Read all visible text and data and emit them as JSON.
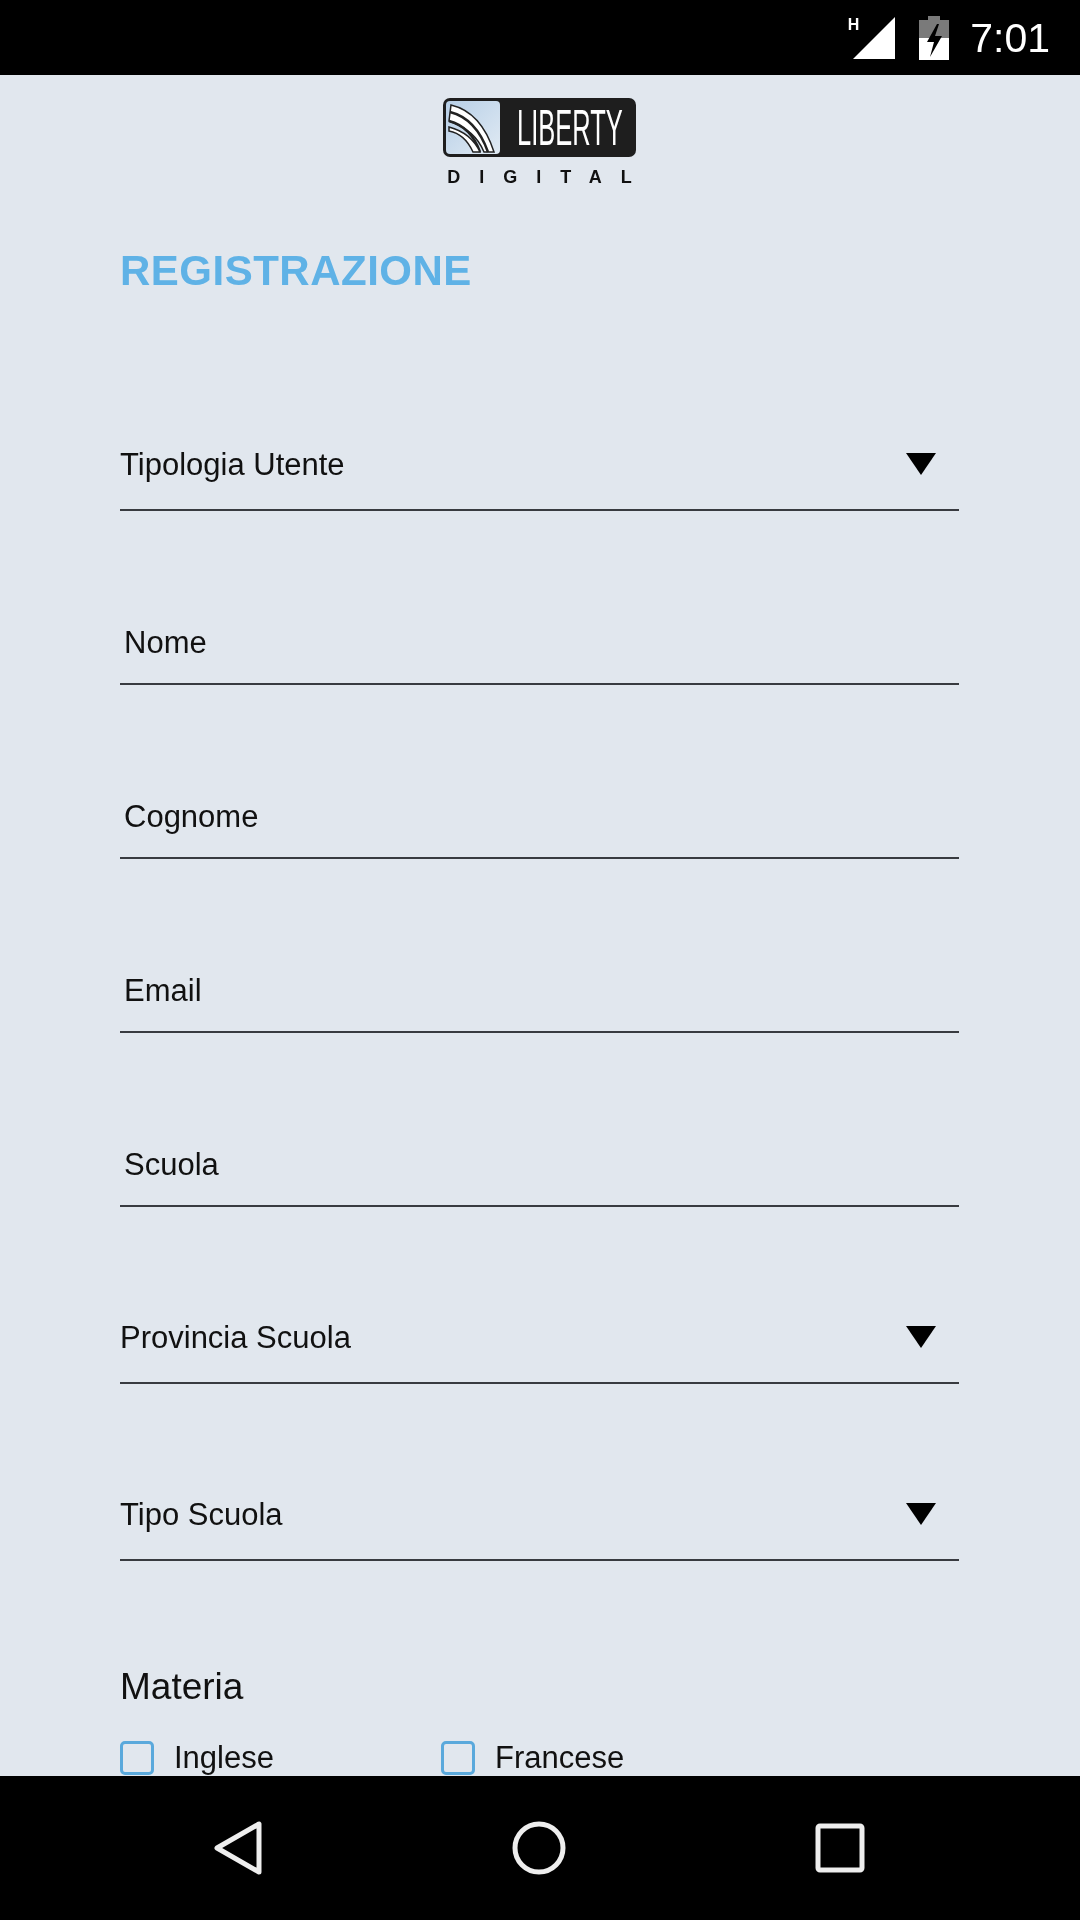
{
  "status_bar": {
    "network": "H",
    "time": "7:01"
  },
  "logo": {
    "name": "LIBERTY",
    "subtitle": "DIGITAL"
  },
  "title": "REGISTRAZIONE",
  "fields": [
    {
      "kind": "dropdown",
      "placeholder": "Tipologia Utente"
    },
    {
      "kind": "text",
      "placeholder": "Nome"
    },
    {
      "kind": "text",
      "placeholder": "Cognome"
    },
    {
      "kind": "text",
      "placeholder": "Email"
    },
    {
      "kind": "text",
      "placeholder": "Scuola"
    },
    {
      "kind": "dropdown",
      "placeholder": "Provincia Scuola"
    },
    {
      "kind": "dropdown",
      "placeholder": "Tipo Scuola"
    }
  ],
  "subject_section": {
    "label": "Materia",
    "options": [
      {
        "label": "Inglese",
        "checked": false
      },
      {
        "label": "Francese",
        "checked": false
      }
    ]
  }
}
